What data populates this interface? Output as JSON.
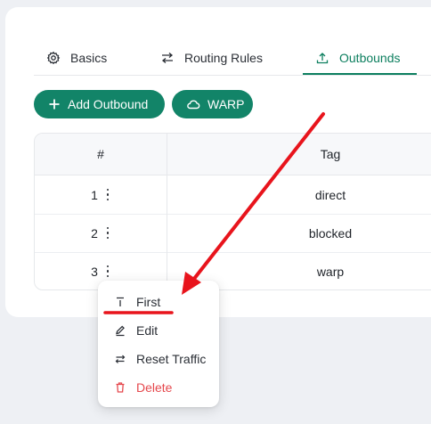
{
  "tabs": [
    {
      "label": "Basics",
      "icon": "gear-icon"
    },
    {
      "label": "Routing Rules",
      "icon": "swap-icon"
    },
    {
      "label": "Outbounds",
      "icon": "upload-icon"
    }
  ],
  "active_tab": "Outbounds",
  "buttons": {
    "add_outbound": "Add Outbound",
    "warp": "WARP"
  },
  "table": {
    "columns": [
      "#",
      "Tag"
    ],
    "rows": [
      {
        "index": "1",
        "tag": "direct"
      },
      {
        "index": "2",
        "tag": "blocked"
      },
      {
        "index": "3",
        "tag": "warp"
      }
    ]
  },
  "menu": {
    "items": [
      {
        "label": "First",
        "icon": "align-top-icon"
      },
      {
        "label": "Edit",
        "icon": "edit-icon"
      },
      {
        "label": "Reset Traffic",
        "icon": "reset-icon"
      },
      {
        "label": "Delete",
        "icon": "trash-icon"
      }
    ]
  },
  "colors": {
    "accent": "#128468",
    "danger": "#e5484d",
    "annotation": "#e8141c"
  }
}
